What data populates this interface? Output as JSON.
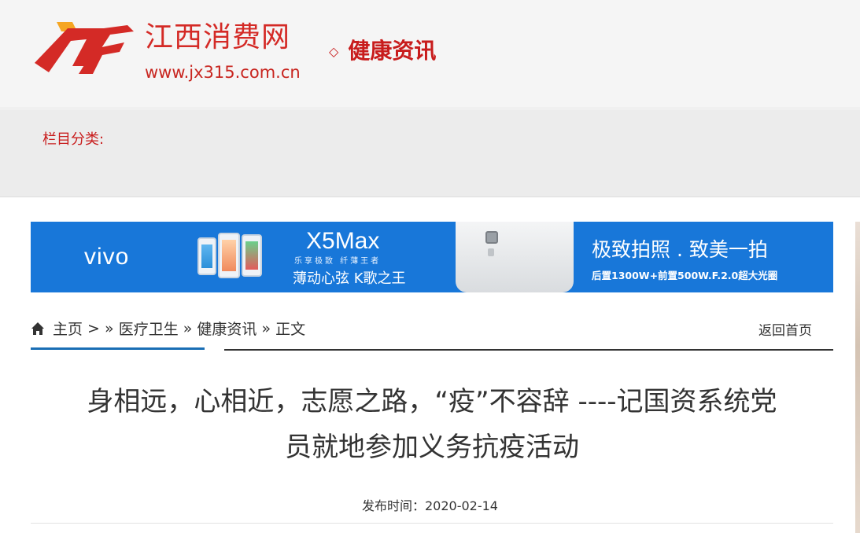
{
  "header": {
    "site_name": "江西消费网",
    "site_url": "www.jx315.com.cn",
    "channel_title": "健康资讯",
    "marker_icon": "diamond-icon"
  },
  "category": {
    "label": "栏目分类:"
  },
  "banner": {
    "brand": "vivo",
    "model": "X5Max",
    "tagline_small": "乐享极致   纤薄王者",
    "tagline": "薄动心弦  K歌之王",
    "slogan": "极致拍照 . 致美一拍",
    "spec": "后置1300W+前置500W.F.2.0超大光圈",
    "color": "#1877d9"
  },
  "breadcrumb": {
    "home": "主页",
    "sep1": " > » ",
    "level1": "医疗卫生",
    "sep2": " » ",
    "level2": "健康资讯",
    "sep3": " » ",
    "level3": "正文",
    "back": "返回首页"
  },
  "article": {
    "title_line1": "身相远，心相近，志愿之路，“疫”不容辞 ----记国资系统党",
    "title_line2": "员就地参加义务抗疫活动",
    "publish_time": "发布时间：2020-02-14"
  },
  "colors": {
    "brand_red": "#c81c1c",
    "link_blue": "#1a6eb5"
  }
}
